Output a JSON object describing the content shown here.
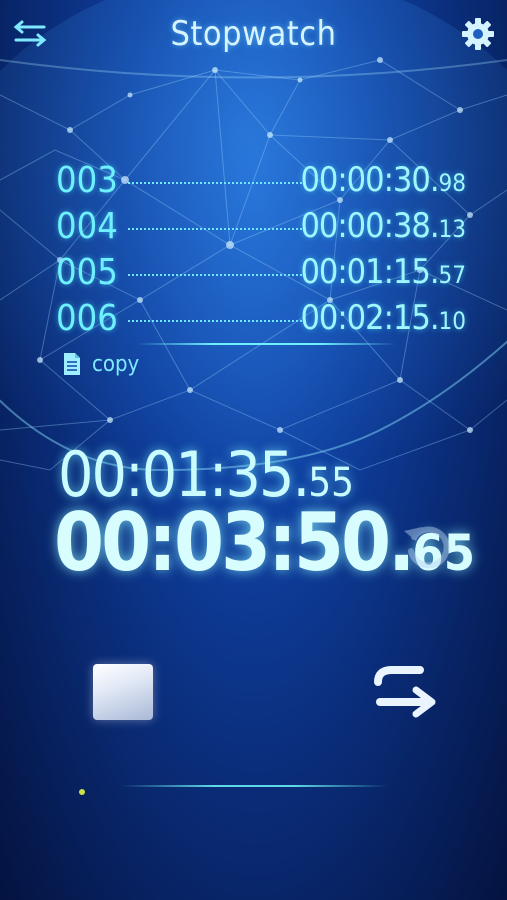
{
  "header": {
    "title": "Stopwatch",
    "menu_icon": "swap-arrows-icon",
    "settings_icon": "gear-icon"
  },
  "laps": [
    {
      "number": "003",
      "time": "00:00:30",
      "centiseconds": "98"
    },
    {
      "number": "004",
      "time": "00:00:38",
      "centiseconds": "13"
    },
    {
      "number": "005",
      "time": "00:01:15",
      "centiseconds": "57"
    },
    {
      "number": "006",
      "time": "00:02:15",
      "centiseconds": "10"
    }
  ],
  "copy": {
    "label": "copy",
    "icon": "document-icon"
  },
  "lap_display": {
    "time": "00:01:35",
    "centiseconds": "55"
  },
  "main_display": {
    "time": "00:03:50",
    "centiseconds": "65"
  },
  "controls": {
    "reset_icon": "reset-icon",
    "stop_icon": "stop-icon",
    "lap_icon": "lap-arrows-icon"
  },
  "colors": {
    "accent": "#6ff0ff",
    "background_dark": "#061c54",
    "background_light": "#1e63c9",
    "indicator": "#c8e24a"
  }
}
